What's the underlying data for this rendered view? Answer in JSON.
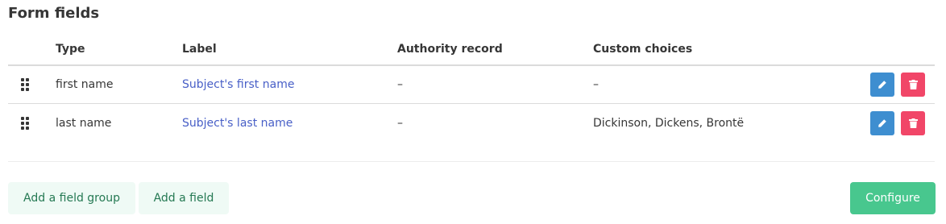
{
  "section": {
    "title": "Form fields"
  },
  "table": {
    "headers": {
      "type": "Type",
      "label": "Label",
      "authority": "Authority record",
      "choices": "Custom choices"
    },
    "rows": [
      {
        "type": "first name",
        "label": "Subject's first name",
        "authority": "–",
        "choices": "–"
      },
      {
        "type": "last name",
        "label": "Subject's last name",
        "authority": "–",
        "choices": "Dickinson, Dickens, Brontë"
      }
    ]
  },
  "actions": {
    "add_group": "Add a field group",
    "add_field": "Add a field",
    "configure": "Configure"
  },
  "colors": {
    "link": "#485fc7",
    "edit": "#3e8ed0",
    "delete": "#f14668",
    "primary": "#48c78e",
    "light_bg": "#effaf5",
    "light_text": "#257953"
  },
  "icons": {
    "handle": "drag-handle-icon",
    "edit": "pencil-icon",
    "delete": "trash-icon"
  }
}
